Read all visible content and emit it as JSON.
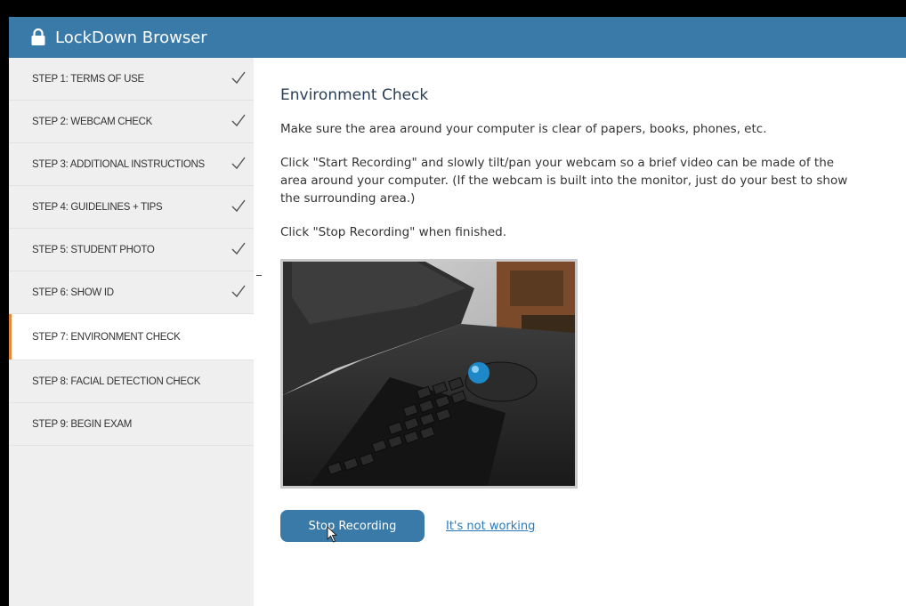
{
  "app": {
    "title": "LockDown Browser"
  },
  "sidebar": {
    "steps": [
      {
        "label": "STEP 1: TERMS OF USE",
        "completed": true
      },
      {
        "label": "STEP 2: WEBCAM CHECK",
        "completed": true
      },
      {
        "label": "STEP 3: ADDITIONAL INSTRUCTIONS",
        "completed": true
      },
      {
        "label": "STEP 4: GUIDELINES + TIPS",
        "completed": true
      },
      {
        "label": "STEP 5: STUDENT PHOTO",
        "completed": true
      },
      {
        "label": "STEP 6: SHOW ID",
        "completed": true
      },
      {
        "label": "STEP 7: ENVIRONMENT CHECK",
        "completed": false,
        "active": true
      },
      {
        "label": "STEP 8: FACIAL DETECTION CHECK",
        "completed": false
      },
      {
        "label": "STEP 9: BEGIN EXAM",
        "completed": false
      }
    ]
  },
  "main": {
    "heading": "Environment Check",
    "paragraphs": [
      "Make sure the area around your computer is clear of papers, books, phones, etc.",
      "Click \"Start Recording\" and slowly tilt/pan your webcam so a brief video can be made of the area around your computer. (If the webcam is built into the monitor, just do your best to show the surrounding area.)",
      "Click \"Stop Recording\" when finished."
    ],
    "stop_button_label": "Stop Recording",
    "not_working_link": "It's not working"
  },
  "colors": {
    "titlebar": "#3a7aa8",
    "button": "#3a7aa8",
    "active_step_accent": "#e8883a",
    "link": "#2a79b8"
  },
  "icons": {
    "title": "lock-icon",
    "step_done": "checkmark-icon",
    "cursor": "mouse-pointer-icon"
  }
}
